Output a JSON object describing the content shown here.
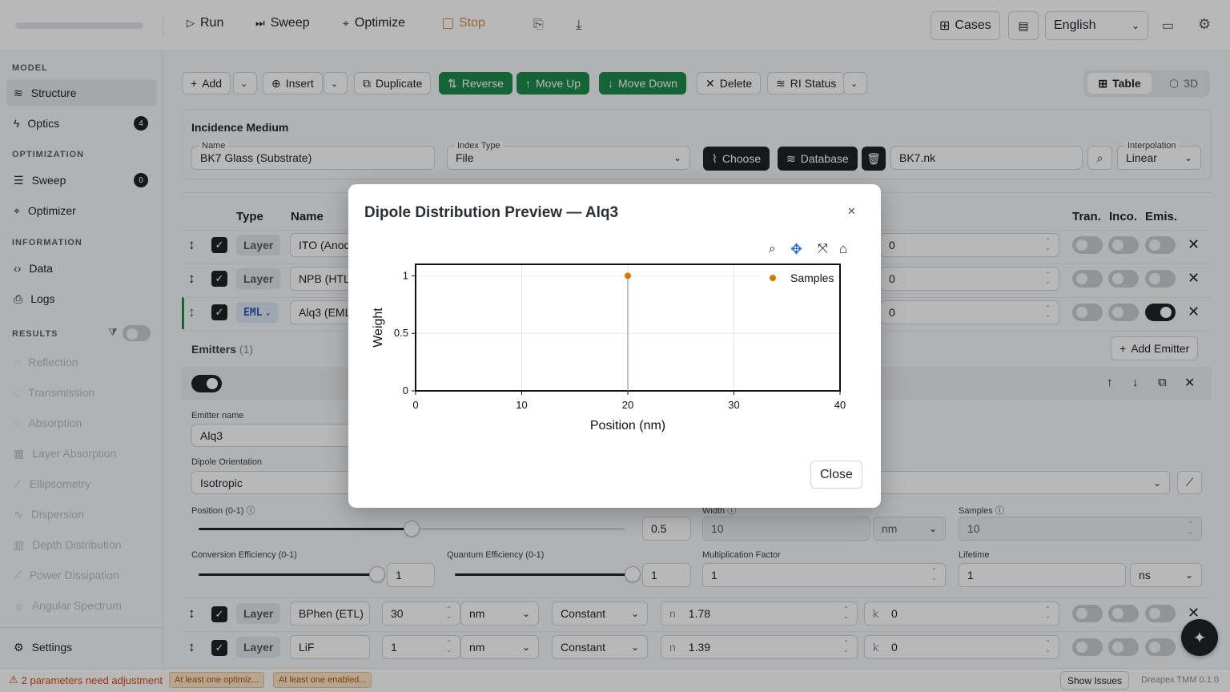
{
  "toolbar": {
    "run": "Run",
    "sweep": "Sweep",
    "optimize": "Optimize",
    "stop": "Stop",
    "cases": "Cases",
    "language": "English"
  },
  "sidebar": {
    "model_header": "MODEL",
    "structure": "Structure",
    "optics": "Optics",
    "optics_badge": "4",
    "optimization_header": "OPTIMIZATION",
    "sweep": "Sweep",
    "sweep_badge": "0",
    "optimizer": "Optimizer",
    "information_header": "INFORMATION",
    "data": "Data",
    "logs": "Logs",
    "results_header": "RESULTS",
    "results": [
      "Reflection",
      "Transmission",
      "Absorption",
      "Layer Absorption",
      "Ellipsometry",
      "Dispersion",
      "Depth Distribution",
      "Power Dissipation",
      "Angular Spectrum"
    ],
    "settings": "Settings"
  },
  "actions": {
    "add": "Add",
    "insert": "Insert",
    "duplicate": "Duplicate",
    "reverse": "Reverse",
    "move_up": "Move Up",
    "move_down": "Move Down",
    "delete": "Delete",
    "ri_status": "RI Status",
    "view_table": "Table",
    "view_3d": "3D"
  },
  "incidence": {
    "title": "Incidence Medium",
    "name_label": "Name",
    "name_value": "BK7 Glass (Substrate)",
    "index_type_label": "Index Type",
    "index_type_value": "File",
    "choose": "Choose",
    "database": "Database",
    "file": "BK7.nk",
    "interp_label": "Interpolation",
    "interp_value": "Linear"
  },
  "table": {
    "col_type": "Type",
    "col_name": "Name",
    "col_tran": "Tran.",
    "col_inco": "Inco.",
    "col_emis": "Emis.",
    "rows": [
      {
        "type": "Layer",
        "name": "ITO (Anod",
        "k": "0"
      },
      {
        "type": "Layer",
        "name": "NPB (HTL",
        "k": "0"
      },
      {
        "type": "EML",
        "name": "Alq3 (EML",
        "k": "0"
      }
    ],
    "bottom_rows": [
      {
        "type": "Layer",
        "name": "BPhen (ETL)",
        "thickness": "30",
        "unit": "nm",
        "model": "Constant",
        "n_label": "n",
        "n": "1.78",
        "k_label": "k",
        "k": "0"
      },
      {
        "type": "Layer",
        "name": "LiF",
        "thickness": "1",
        "unit": "nm",
        "model": "Constant",
        "n_label": "n",
        "n": "1.39",
        "k_label": "k",
        "k": "0"
      }
    ]
  },
  "emitters": {
    "title": "Emitters",
    "count": "(1)",
    "add": "Add Emitter",
    "name_label": "Emitter name",
    "name_value": "Alq3",
    "dipole_label": "Dipole Orientation",
    "dipole_value": "Isotropic",
    "position_label": "Position (0-1)",
    "position_value": "0.5",
    "width_label": "Width",
    "width_value": "10",
    "width_unit": "nm",
    "samples_label": "Samples",
    "samples_value": "10",
    "conv_label": "Conversion Efficiency (0-1)",
    "conv_value": "1",
    "qe_label": "Quantum Efficiency (0-1)",
    "qe_value": "1",
    "mult_label": "Multiplication Factor",
    "mult_value": "1",
    "lifetime_label": "Lifetime",
    "lifetime_value": "1",
    "lifetime_unit": "ns",
    "position_fraction": 0.5,
    "conv_fraction": 1,
    "qe_fraction": 1
  },
  "status": {
    "warning": "2 parameters need adjustment",
    "tags": [
      "At least one optimiz...",
      "At least one enabled..."
    ],
    "show_issues": "Show Issues",
    "version": "Dreapex TMM 0.1.0"
  },
  "modal": {
    "title": "Dipole Distribution Preview — Alq3",
    "close": "Close"
  },
  "chart_data": {
    "type": "scatter",
    "title": "",
    "xlabel": "Position (nm)",
    "ylabel": "Weight",
    "xlim": [
      0,
      40
    ],
    "ylim": [
      0,
      1.1
    ],
    "xticks": [
      0,
      10,
      20,
      30,
      40
    ],
    "yticks": [
      0,
      0.5,
      1
    ],
    "grid": true,
    "legend_position": "top-right",
    "series": [
      {
        "name": "Samples",
        "x": [
          20
        ],
        "y": [
          1
        ],
        "color": "#d97706"
      }
    ],
    "stems": true
  }
}
